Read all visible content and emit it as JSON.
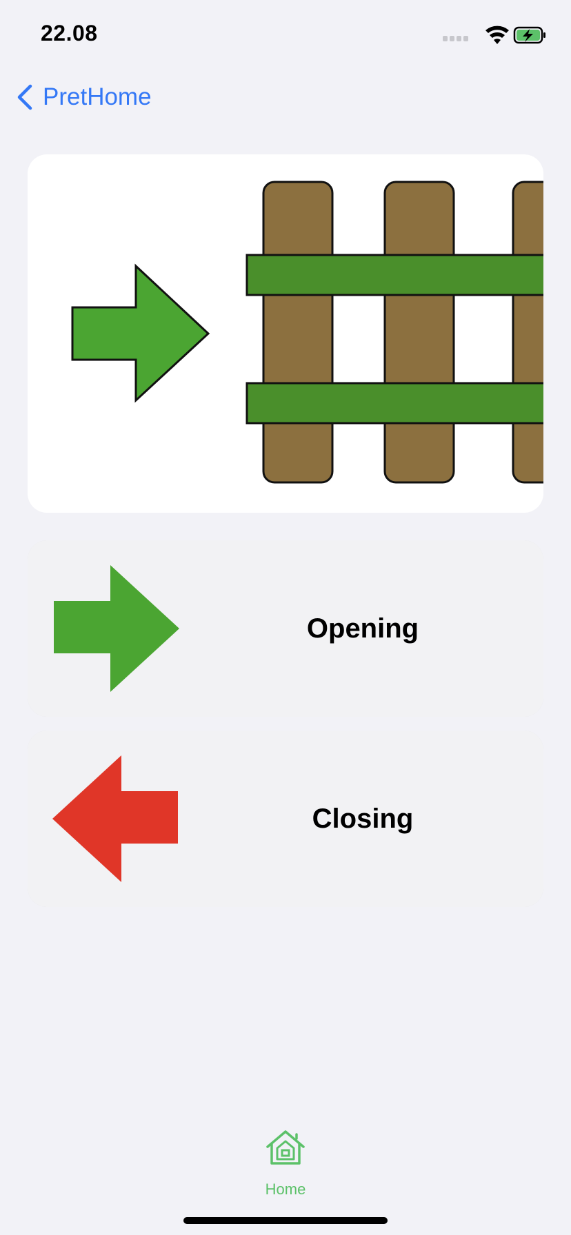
{
  "status_bar": {
    "time": "22.08"
  },
  "nav": {
    "back_label": "PretHome"
  },
  "actions": [
    {
      "label": "Opening",
      "arrow": "right-arrow-icon",
      "color": "#4ba532"
    },
    {
      "label": "Closing",
      "arrow": "left-arrow-icon",
      "color": "#e03628"
    }
  ],
  "tab_bar": {
    "home_label": "Home",
    "active_color": "#5cc169"
  },
  "colors": {
    "accent": "#3478f6",
    "fence": "#8c703f",
    "green": "#4ba532",
    "red": "#e03628"
  }
}
